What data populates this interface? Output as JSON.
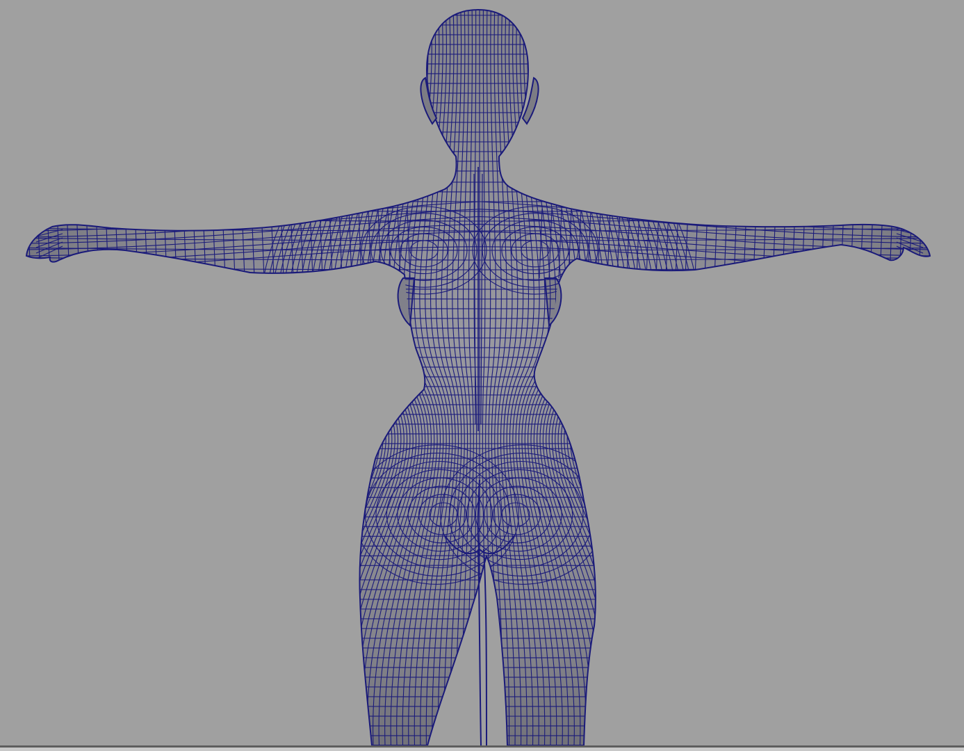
{
  "viewport": {
    "background_color": "#a0a0a0",
    "camera": "back-orthographic"
  },
  "model": {
    "type": "female-base-mesh",
    "pose": "T-pose",
    "view": "back",
    "surface_color": "#8a8a90",
    "wireframe_color": "#1a1a7a",
    "display_mode": "smooth-shade-with-wireframe"
  }
}
